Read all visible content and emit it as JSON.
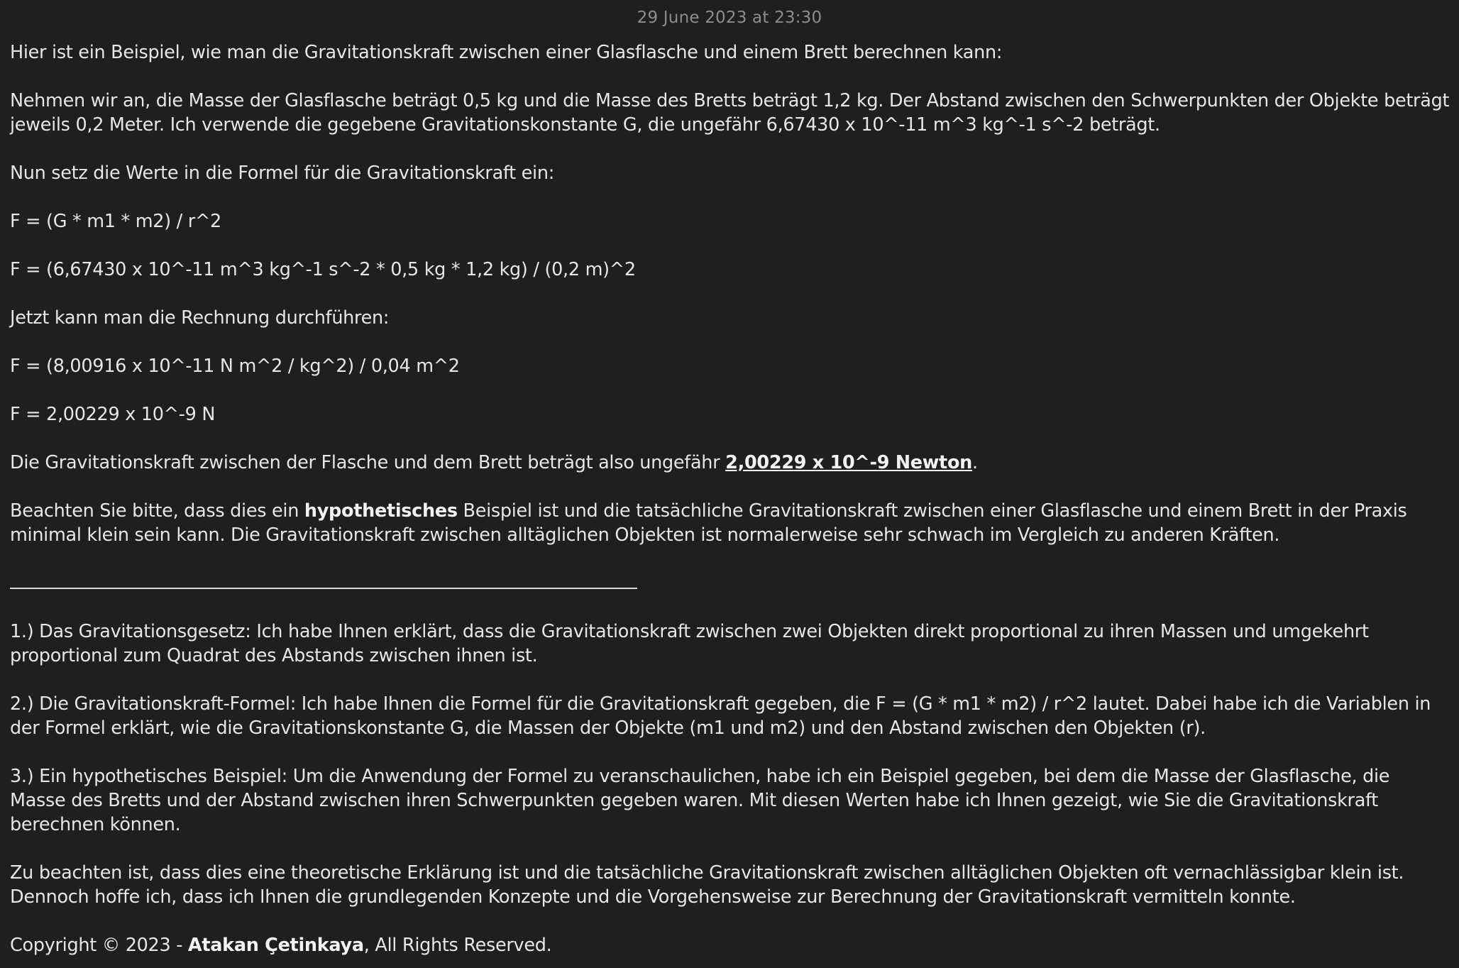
{
  "date": "29 June 2023 at 23:30",
  "paragraphs": {
    "intro": "Hier ist ein Beispiel, wie man die Gravitationskraft zwischen einer Glasflasche und einem Brett berechnen kann:",
    "assumption": "Nehmen wir an, die Masse der Glasflasche beträgt 0,5 kg und die Masse des Bretts beträgt 1,2 kg. Der Abstand zwischen den Schwerpunkten der Objekte beträgt jeweils 0,2 Meter. Ich verwende die gegebene Gravitationskonstante G, die ungefähr 6,67430 x 10^-11 m^3 kg^-1 s^-2 beträgt.",
    "insert": "Nun setz die Werte in die Formel für die Gravitationskraft ein:",
    "formula1": "F = (G * m1 * m2) / r^2",
    "formula2": "F = (6,67430 x 10^-11 m^3 kg^-1 s^-2 * 0,5 kg * 1,2 kg) / (0,2 m)^2",
    "compute": "Jetzt kann man die Rechnung durchführen:",
    "formula3": "F = (8,00916 x 10^-11 N m^2 / kg^2) / 0,04 m^2",
    "formula4": "F = 2,00229 x 10^-9 N",
    "result_before": "Die Gravitationskraft zwischen der Flasche und dem Brett beträgt also ungefähr ",
    "result_value": "2,00229 x 10^-9 Newton",
    "result_after": ".",
    "note_before": "Beachten Sie bitte, dass dies ein ",
    "note_bold": "hypothetisches",
    "note_after": " Beispiel ist und die tatsächliche Gravitationskraft zwischen einer Glasflasche und einem Brett in der Praxis minimal klein sein kann. Die Gravitationskraft zwischen alltäglichen Objekten ist normalerweise sehr schwach im Vergleich zu anderen Kräften.",
    "point1": "1.) Das Gravitationsgesetz: Ich habe Ihnen erklärt, dass die Gravitationskraft zwischen zwei Objekten direkt proportional zu ihren Massen und umgekehrt proportional zum Quadrat des Abstands zwischen ihnen ist.",
    "point2": "2.) Die Gravitationskraft-Formel: Ich habe Ihnen die Formel für die Gravitationskraft gegeben, die F = (G * m1 * m2) / r^2 lautet. Dabei habe ich die Variablen in der Formel erklärt, wie die Gravitationskonstante G, die Massen der Objekte (m1 und m2) und den Abstand zwischen den Objekten (r).",
    "point3": "3.) Ein hypothetisches Beispiel: Um die Anwendung der Formel zu veranschaulichen, habe ich ein Beispiel gegeben, bei dem die Masse der Glasflasche, die Masse des Bretts und der Abstand zwischen ihren Schwerpunkten gegeben waren. Mit diesen Werten habe ich Ihnen gezeigt, wie Sie die Gravitationskraft berechnen können.",
    "closing": "Zu beachten ist, dass dies eine theoretische Erklärung ist und die tatsächliche Gravitationskraft zwischen alltäglichen Objekten oft vernachlässigbar klein ist. Dennoch hoffe ich, dass ich Ihnen die grundlegenden Konzepte und die Vorgehensweise zur Berechnung der Gravitationskraft vermitteln konnte."
  },
  "footer": {
    "prefix": "Copyright © 2023 - ",
    "author": "Atakan Çetinkaya",
    "suffix": ", All Rights Reserved."
  },
  "colors": {
    "background": "#1f1f20",
    "text": "#e6e6e6",
    "date_text": "#8d8d8f"
  }
}
